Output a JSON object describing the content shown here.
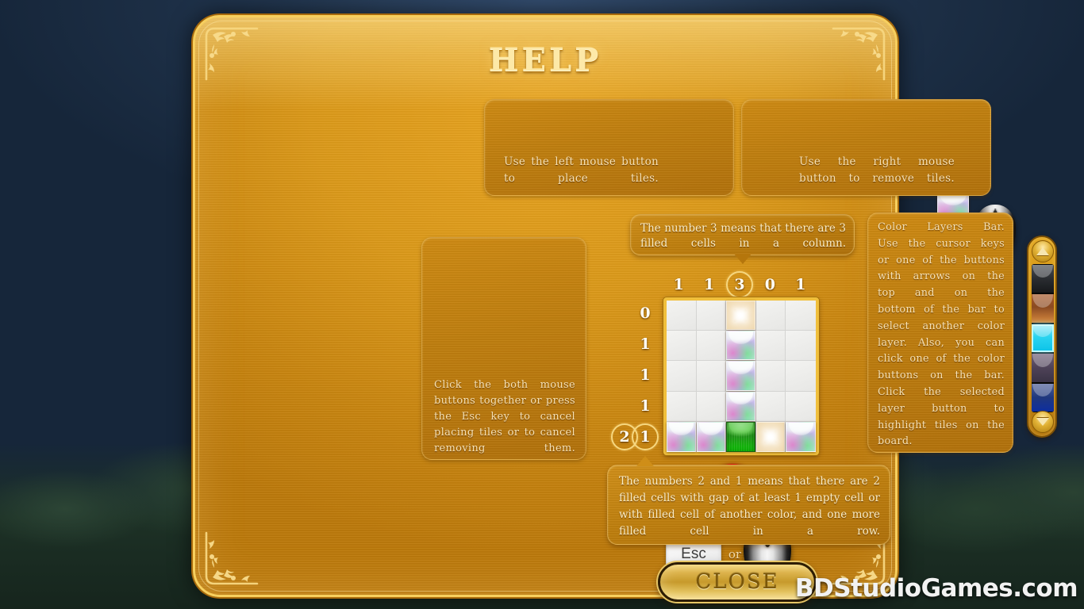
{
  "window": {
    "title": "HELP",
    "close_label": "CLOSE"
  },
  "watermark": "BDStudioGames.com",
  "panels": {
    "left_mouse": {
      "text": "Use the left mouse button to place tiles.",
      "tile_icon": "rainbow-tile-icon",
      "mouse_icon": "mouse-left-button-icon",
      "highlight": "left"
    },
    "right_mouse": {
      "text": "Use the right mouse button to remove tiles.",
      "tile_icon": "cross-tile-icon",
      "mouse_icon": "mouse-right-button-icon",
      "highlight": "right"
    },
    "cancel": {
      "text": "Click the both mouse buttons together or press the Esc key to cancel placing tiles or to cancel removing them.",
      "esc_label": "Esc",
      "or_label": "or",
      "no_icon": "prohibition-sign-icon",
      "mouse_icon": "mouse-both-buttons-icon"
    },
    "color_layers": {
      "lines": [
        "Color Layers Bar.",
        "Use the cursor keys",
        "or one of the buttons",
        "with arrows on the",
        "top and on the",
        "bottom of the bar to",
        "select another color",
        "layer. Also, you can",
        "click one of the color",
        "buttons on the bar.",
        "Click the selected",
        "layer button to",
        "highlight tiles on the",
        "board."
      ]
    }
  },
  "tooltips": {
    "column_hint": "The number 3 means that there are 3 filled cells in a column.",
    "row_hint": "The numbers 2 and 1 means that there are 2 filled cells with gap of at least 1 empty cell or with filled cell of another color, and one more filled cell in a row."
  },
  "puzzle": {
    "column_clues": [
      {
        "value": "1",
        "circled": false
      },
      {
        "value": "1",
        "circled": false
      },
      {
        "value": "3",
        "circled": true
      },
      {
        "value": "0",
        "circled": false
      },
      {
        "value": "1",
        "circled": false
      }
    ],
    "row_clues": [
      {
        "values": [
          {
            "value": "0",
            "circled": false
          }
        ]
      },
      {
        "values": [
          {
            "value": "1",
            "circled": false
          }
        ]
      },
      {
        "values": [
          {
            "value": "1",
            "circled": false
          }
        ]
      },
      {
        "values": [
          {
            "value": "1",
            "circled": false
          }
        ]
      },
      {
        "values": [
          {
            "value": "2",
            "circled": true
          },
          {
            "value": "1",
            "circled": true
          }
        ]
      }
    ],
    "cells": [
      "empty",
      "empty",
      "cross",
      "empty",
      "empty",
      "empty",
      "empty",
      "rainbow",
      "empty",
      "empty",
      "empty",
      "empty",
      "rainbow",
      "empty",
      "empty",
      "empty",
      "empty",
      "rainbow",
      "empty",
      "empty",
      "rainbow",
      "rainbow",
      "green",
      "cross",
      "rainbow"
    ]
  },
  "color_layers_bar": {
    "up_arrow": "arrow-up-icon",
    "down_arrow": "arrow-down-icon",
    "swatches": [
      {
        "name": "layer-dark-gray",
        "color": "#32353a",
        "selected": false
      },
      {
        "name": "layer-rust-brown",
        "color": "#8a4a22",
        "selected": false
      },
      {
        "name": "layer-cyan",
        "color": "#2ad4f0",
        "selected": true
      },
      {
        "name": "layer-violet",
        "color": "#5a4a66",
        "selected": false
      },
      {
        "name": "layer-deep-blue",
        "color": "#1d3a80",
        "selected": false
      }
    ]
  },
  "colors": {
    "panel_gold": "#dc9a1b",
    "panel_border": "#f7cf5e",
    "title_text": "#fde9a8",
    "body_text": "#f7e2b4",
    "accent_orange": "#fb9a17",
    "prohibition_red": "#e01a10",
    "background_sky": "#22364f"
  }
}
